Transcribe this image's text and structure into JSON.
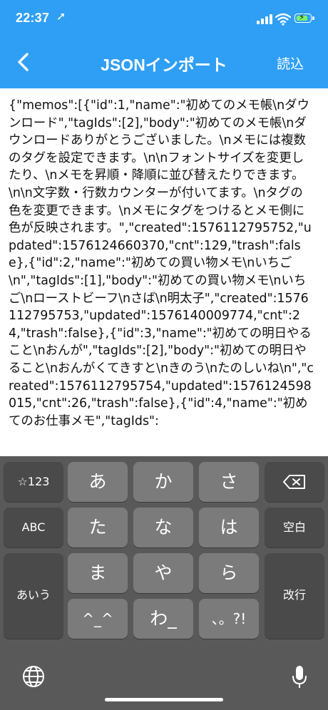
{
  "status": {
    "time": "22:37",
    "location_icon": "➚"
  },
  "nav": {
    "title": "JSONインポート",
    "read_label": "読込"
  },
  "content": {
    "text": "{\"memos\":[{\"id\":1,\"name\":\"初めてのメモ帳\\nダウンロード\",\"tagIds\":[2],\"body\":\"初めてのメモ帳\\nダウンロードありがとうございました。\\nメモには複数のタグを設定できます。\\n\\nフォントサイズを変更したり、\\nメモを昇順・降順に並び替えたりできます。\\n\\n文字数・行数カウンターが付いてます。\\nタグの色を変更できます。\\nメモにタグをつけるとメモ側に色が反映されます。\",\"created\":1576112795752,\"updated\":1576124660370,\"cnt\":129,\"trash\":false},{\"id\":2,\"name\":\"初めての買い物メモ\\nいちご\\n\",\"tagIds\":[1],\"body\":\"初めての買い物メモ\\nいちご\\nローストビーフ\\nさば\\n明太子\",\"created\":1576112795753,\"updated\":1576140009774,\"cnt\":24,\"trash\":false},{\"id\":3,\"name\":\"初めての明日やること\\nおんが\",\"tagIds\":[2],\"body\":\"初めての明日やること\\nおんがくてきすと\\nきのう\\nたのしいね\\n\",\"created\":1576112795754,\"updated\":1576124598015,\"cnt\":26,\"trash\":false},{\"id\":4,\"name\":\"初めてのお仕事メモ\",\"tagIds\":"
  },
  "keyboard": {
    "k123": "☆123",
    "a": "あ",
    "ka": "か",
    "sa": "さ",
    "abc": "ABC",
    "ta": "た",
    "na": "な",
    "ha": "は",
    "space": "空白",
    "ma": "ま",
    "ya": "や",
    "ra": "ら",
    "aiu": "あいう",
    "kaigyo": "改行",
    "hat": "^_^",
    "wa": "わ_",
    "punct": "、。?!"
  },
  "colors": {
    "nav_bg": "#2f9ff5",
    "keyboard_bg": "#595959"
  }
}
